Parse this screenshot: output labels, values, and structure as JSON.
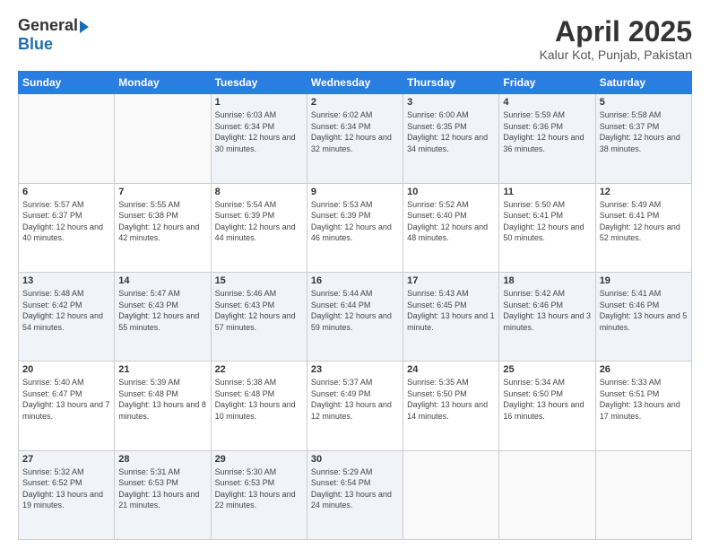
{
  "logo": {
    "general": "General",
    "blue": "Blue"
  },
  "header": {
    "month": "April 2025",
    "location": "Kalur Kot, Punjab, Pakistan"
  },
  "days_of_week": [
    "Sunday",
    "Monday",
    "Tuesday",
    "Wednesday",
    "Thursday",
    "Friday",
    "Saturday"
  ],
  "weeks": [
    [
      {
        "day": "",
        "sunrise": "",
        "sunset": "",
        "daylight": ""
      },
      {
        "day": "",
        "sunrise": "",
        "sunset": "",
        "daylight": ""
      },
      {
        "day": "1",
        "sunrise": "Sunrise: 6:03 AM",
        "sunset": "Sunset: 6:34 PM",
        "daylight": "Daylight: 12 hours and 30 minutes."
      },
      {
        "day": "2",
        "sunrise": "Sunrise: 6:02 AM",
        "sunset": "Sunset: 6:34 PM",
        "daylight": "Daylight: 12 hours and 32 minutes."
      },
      {
        "day": "3",
        "sunrise": "Sunrise: 6:00 AM",
        "sunset": "Sunset: 6:35 PM",
        "daylight": "Daylight: 12 hours and 34 minutes."
      },
      {
        "day": "4",
        "sunrise": "Sunrise: 5:59 AM",
        "sunset": "Sunset: 6:36 PM",
        "daylight": "Daylight: 12 hours and 36 minutes."
      },
      {
        "day": "5",
        "sunrise": "Sunrise: 5:58 AM",
        "sunset": "Sunset: 6:37 PM",
        "daylight": "Daylight: 12 hours and 38 minutes."
      }
    ],
    [
      {
        "day": "6",
        "sunrise": "Sunrise: 5:57 AM",
        "sunset": "Sunset: 6:37 PM",
        "daylight": "Daylight: 12 hours and 40 minutes."
      },
      {
        "day": "7",
        "sunrise": "Sunrise: 5:55 AM",
        "sunset": "Sunset: 6:38 PM",
        "daylight": "Daylight: 12 hours and 42 minutes."
      },
      {
        "day": "8",
        "sunrise": "Sunrise: 5:54 AM",
        "sunset": "Sunset: 6:39 PM",
        "daylight": "Daylight: 12 hours and 44 minutes."
      },
      {
        "day": "9",
        "sunrise": "Sunrise: 5:53 AM",
        "sunset": "Sunset: 6:39 PM",
        "daylight": "Daylight: 12 hours and 46 minutes."
      },
      {
        "day": "10",
        "sunrise": "Sunrise: 5:52 AM",
        "sunset": "Sunset: 6:40 PM",
        "daylight": "Daylight: 12 hours and 48 minutes."
      },
      {
        "day": "11",
        "sunrise": "Sunrise: 5:50 AM",
        "sunset": "Sunset: 6:41 PM",
        "daylight": "Daylight: 12 hours and 50 minutes."
      },
      {
        "day": "12",
        "sunrise": "Sunrise: 5:49 AM",
        "sunset": "Sunset: 6:41 PM",
        "daylight": "Daylight: 12 hours and 52 minutes."
      }
    ],
    [
      {
        "day": "13",
        "sunrise": "Sunrise: 5:48 AM",
        "sunset": "Sunset: 6:42 PM",
        "daylight": "Daylight: 12 hours and 54 minutes."
      },
      {
        "day": "14",
        "sunrise": "Sunrise: 5:47 AM",
        "sunset": "Sunset: 6:43 PM",
        "daylight": "Daylight: 12 hours and 55 minutes."
      },
      {
        "day": "15",
        "sunrise": "Sunrise: 5:46 AM",
        "sunset": "Sunset: 6:43 PM",
        "daylight": "Daylight: 12 hours and 57 minutes."
      },
      {
        "day": "16",
        "sunrise": "Sunrise: 5:44 AM",
        "sunset": "Sunset: 6:44 PM",
        "daylight": "Daylight: 12 hours and 59 minutes."
      },
      {
        "day": "17",
        "sunrise": "Sunrise: 5:43 AM",
        "sunset": "Sunset: 6:45 PM",
        "daylight": "Daylight: 13 hours and 1 minute."
      },
      {
        "day": "18",
        "sunrise": "Sunrise: 5:42 AM",
        "sunset": "Sunset: 6:46 PM",
        "daylight": "Daylight: 13 hours and 3 minutes."
      },
      {
        "day": "19",
        "sunrise": "Sunrise: 5:41 AM",
        "sunset": "Sunset: 6:46 PM",
        "daylight": "Daylight: 13 hours and 5 minutes."
      }
    ],
    [
      {
        "day": "20",
        "sunrise": "Sunrise: 5:40 AM",
        "sunset": "Sunset: 6:47 PM",
        "daylight": "Daylight: 13 hours and 7 minutes."
      },
      {
        "day": "21",
        "sunrise": "Sunrise: 5:39 AM",
        "sunset": "Sunset: 6:48 PM",
        "daylight": "Daylight: 13 hours and 8 minutes."
      },
      {
        "day": "22",
        "sunrise": "Sunrise: 5:38 AM",
        "sunset": "Sunset: 6:48 PM",
        "daylight": "Daylight: 13 hours and 10 minutes."
      },
      {
        "day": "23",
        "sunrise": "Sunrise: 5:37 AM",
        "sunset": "Sunset: 6:49 PM",
        "daylight": "Daylight: 13 hours and 12 minutes."
      },
      {
        "day": "24",
        "sunrise": "Sunrise: 5:35 AM",
        "sunset": "Sunset: 6:50 PM",
        "daylight": "Daylight: 13 hours and 14 minutes."
      },
      {
        "day": "25",
        "sunrise": "Sunrise: 5:34 AM",
        "sunset": "Sunset: 6:50 PM",
        "daylight": "Daylight: 13 hours and 16 minutes."
      },
      {
        "day": "26",
        "sunrise": "Sunrise: 5:33 AM",
        "sunset": "Sunset: 6:51 PM",
        "daylight": "Daylight: 13 hours and 17 minutes."
      }
    ],
    [
      {
        "day": "27",
        "sunrise": "Sunrise: 5:32 AM",
        "sunset": "Sunset: 6:52 PM",
        "daylight": "Daylight: 13 hours and 19 minutes."
      },
      {
        "day": "28",
        "sunrise": "Sunrise: 5:31 AM",
        "sunset": "Sunset: 6:53 PM",
        "daylight": "Daylight: 13 hours and 21 minutes."
      },
      {
        "day": "29",
        "sunrise": "Sunrise: 5:30 AM",
        "sunset": "Sunset: 6:53 PM",
        "daylight": "Daylight: 13 hours and 22 minutes."
      },
      {
        "day": "30",
        "sunrise": "Sunrise: 5:29 AM",
        "sunset": "Sunset: 6:54 PM",
        "daylight": "Daylight: 13 hours and 24 minutes."
      },
      {
        "day": "",
        "sunrise": "",
        "sunset": "",
        "daylight": ""
      },
      {
        "day": "",
        "sunrise": "",
        "sunset": "",
        "daylight": ""
      },
      {
        "day": "",
        "sunrise": "",
        "sunset": "",
        "daylight": ""
      }
    ]
  ]
}
